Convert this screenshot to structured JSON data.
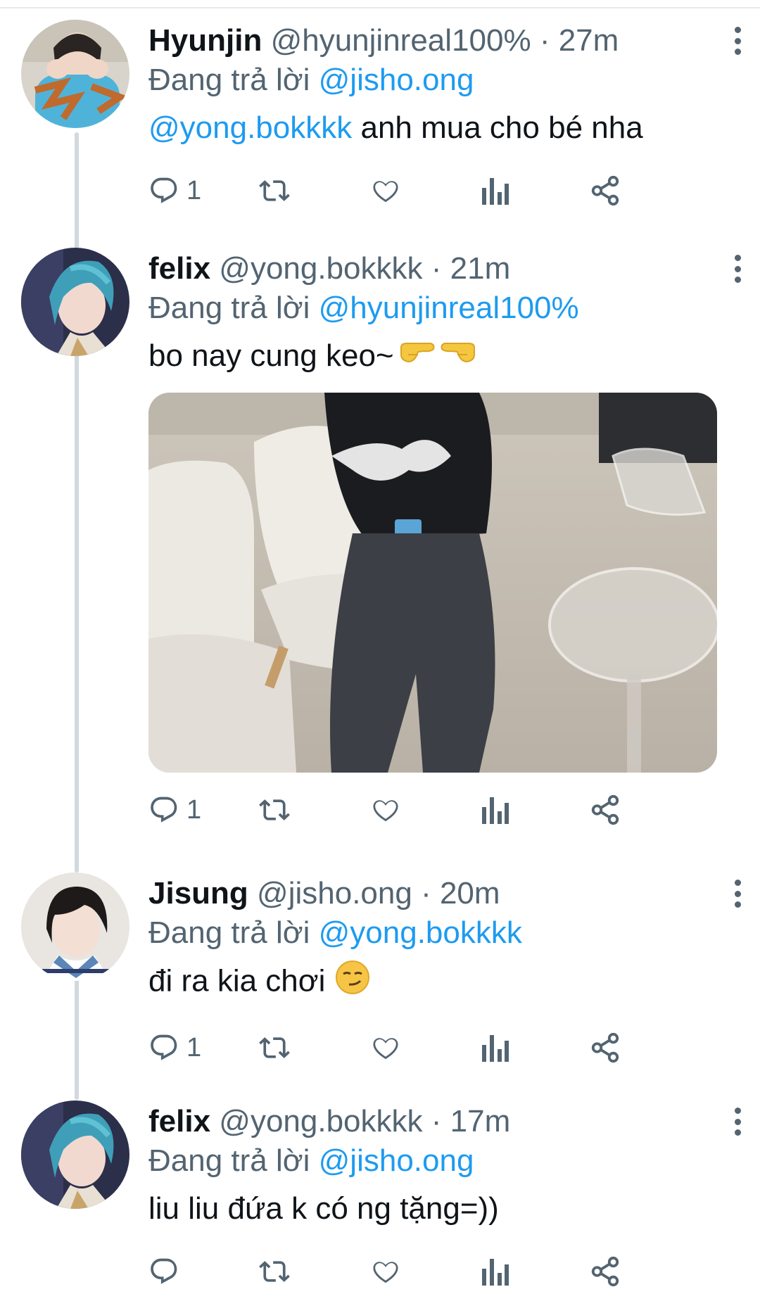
{
  "tweets": [
    {
      "name": "Hyunjin",
      "handle": "@hyunjinreal100%",
      "time": "· 27m",
      "reply_prefix": "Đang trả lời",
      "reply_to": "@jisho.ong",
      "text_mention": "@yong.bokkkk",
      "text": " anh mua cho bé nha",
      "reply_count": "1",
      "emoji": []
    },
    {
      "name": "felix",
      "handle": "@yong.bokkkk",
      "time": "· 21m",
      "reply_prefix": "Đang trả lời",
      "reply_to": "@hyunjinreal100%",
      "text": "bo nay cung keo~",
      "reply_count": "1",
      "emoji": [
        "pointing-right-emoji",
        "pointing-left-emoji"
      ]
    },
    {
      "name": "Jisung",
      "handle": "@jisho.ong",
      "time": "· 20m",
      "reply_prefix": "Đang trả lời",
      "reply_to": "@yong.bokkkk",
      "text": "đi ra kia chơi",
      "reply_count": "1",
      "emoji": [
        "smirking-face-emoji"
      ]
    },
    {
      "name": "felix",
      "handle": "@yong.bokkkk",
      "time": "· 17m",
      "reply_prefix": "Đang trả lời",
      "reply_to": "@jisho.ong",
      "text": "liu liu đứa k có ng tặng=))",
      "reply_count": "",
      "emoji": []
    }
  ],
  "icons": {
    "reply": "reply-icon",
    "retweet": "retweet-icon",
    "like": "like-icon",
    "views": "views-icon",
    "share": "share-icon",
    "more": "more-options-icon"
  },
  "colors": {
    "link": "#1d9bf0",
    "secondary_text": "#536471",
    "thread_line": "#cfd9de"
  }
}
